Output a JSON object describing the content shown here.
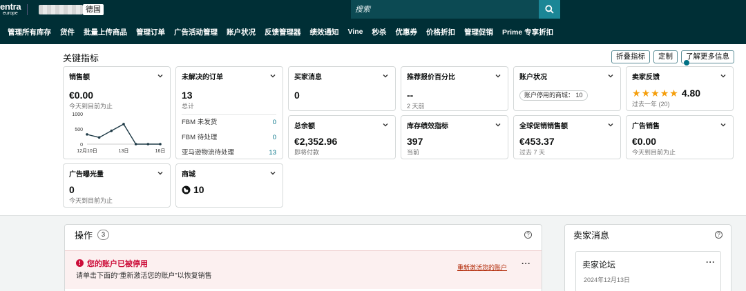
{
  "topbar": {
    "logo_line1": "entra",
    "logo_line2": "europe",
    "marketplace": "德国",
    "search_placeholder": "搜索"
  },
  "nav": [
    "管理所有库存",
    "货件",
    "批量上传商品",
    "管理订单",
    "广告活动管理",
    "账户状况",
    "反馈管理器",
    "绩效通知",
    "Vine",
    "秒杀",
    "优惠券",
    "价格折扣",
    "管理促销",
    "Prime 专享折扣"
  ],
  "kpi": {
    "title": "关键指标",
    "actions": {
      "collapse": "折叠指标",
      "customize": "定制",
      "learn_more": "了解更多信息"
    },
    "sales": {
      "title": "销售额",
      "value": "€0.00",
      "sub": "今天到目前为止",
      "chart_data": {
        "type": "line",
        "x": [
          "12月10日",
          "12月11日",
          "12月12日",
          "12月13日",
          "12月14日",
          "12月15日",
          "12月16日"
        ],
        "values": [
          320,
          220,
          440,
          660,
          0,
          0,
          0
        ],
        "yticks": [
          "1000",
          "500",
          "0"
        ],
        "xticks": [
          "12月10日",
          "13日",
          "16日"
        ],
        "ylim": [
          0,
          1000
        ]
      }
    },
    "open_orders": {
      "title": "未解决的订单",
      "value": "13",
      "sub": "总计",
      "rows": [
        {
          "label": "FBM 未发货",
          "value": "0"
        },
        {
          "label": "FBM 待处理",
          "value": "0"
        },
        {
          "label": "亚马逊物流待处理",
          "value": "13"
        }
      ]
    },
    "buyer_messages": {
      "title": "买家消息",
      "value": "0"
    },
    "featured_offer": {
      "title": "推荐报价百分比",
      "value": "--",
      "sub": "2 天前"
    },
    "account_health": {
      "title": "账户状况",
      "badge": "账户停用的商城： 10"
    },
    "seller_feedback": {
      "title": "卖家反馈",
      "rating": "4.80",
      "sub": "过去一年 (20)",
      "stars": 5
    },
    "total_balance": {
      "title": "总余额",
      "value": "€2,352.96",
      "sub": "即将付款"
    },
    "inventory_perf": {
      "title": "库存绩效指标",
      "value": "397",
      "sub": "当前"
    },
    "global_promo": {
      "title": "全球促销销售额",
      "value": "€453.37",
      "sub": "过去 7 天"
    },
    "ad_sales": {
      "title": "广告销售",
      "value": "€0.00",
      "sub": "今天到目前为止"
    },
    "ad_impressions": {
      "title": "广告曝光量",
      "value": "0",
      "sub": "今天到目前为止"
    },
    "marketplaces": {
      "title": "商城",
      "value": "10"
    }
  },
  "actions_panel": {
    "title": "操作",
    "count": "3",
    "alert_title": "您的账户已被停用",
    "alert_desc": "请单击下面的“重新激活您的账户”以恢复销售",
    "alert_link": "重新激活您的账户"
  },
  "seller_messages_panel": {
    "title": "卖家消息",
    "forum_title": "卖家论坛",
    "forum_date": "2024年12月13日"
  },
  "colors": {
    "header": "#002f36",
    "accent": "#007185",
    "alert": "#cc0c39",
    "star": "#f59e0b"
  }
}
